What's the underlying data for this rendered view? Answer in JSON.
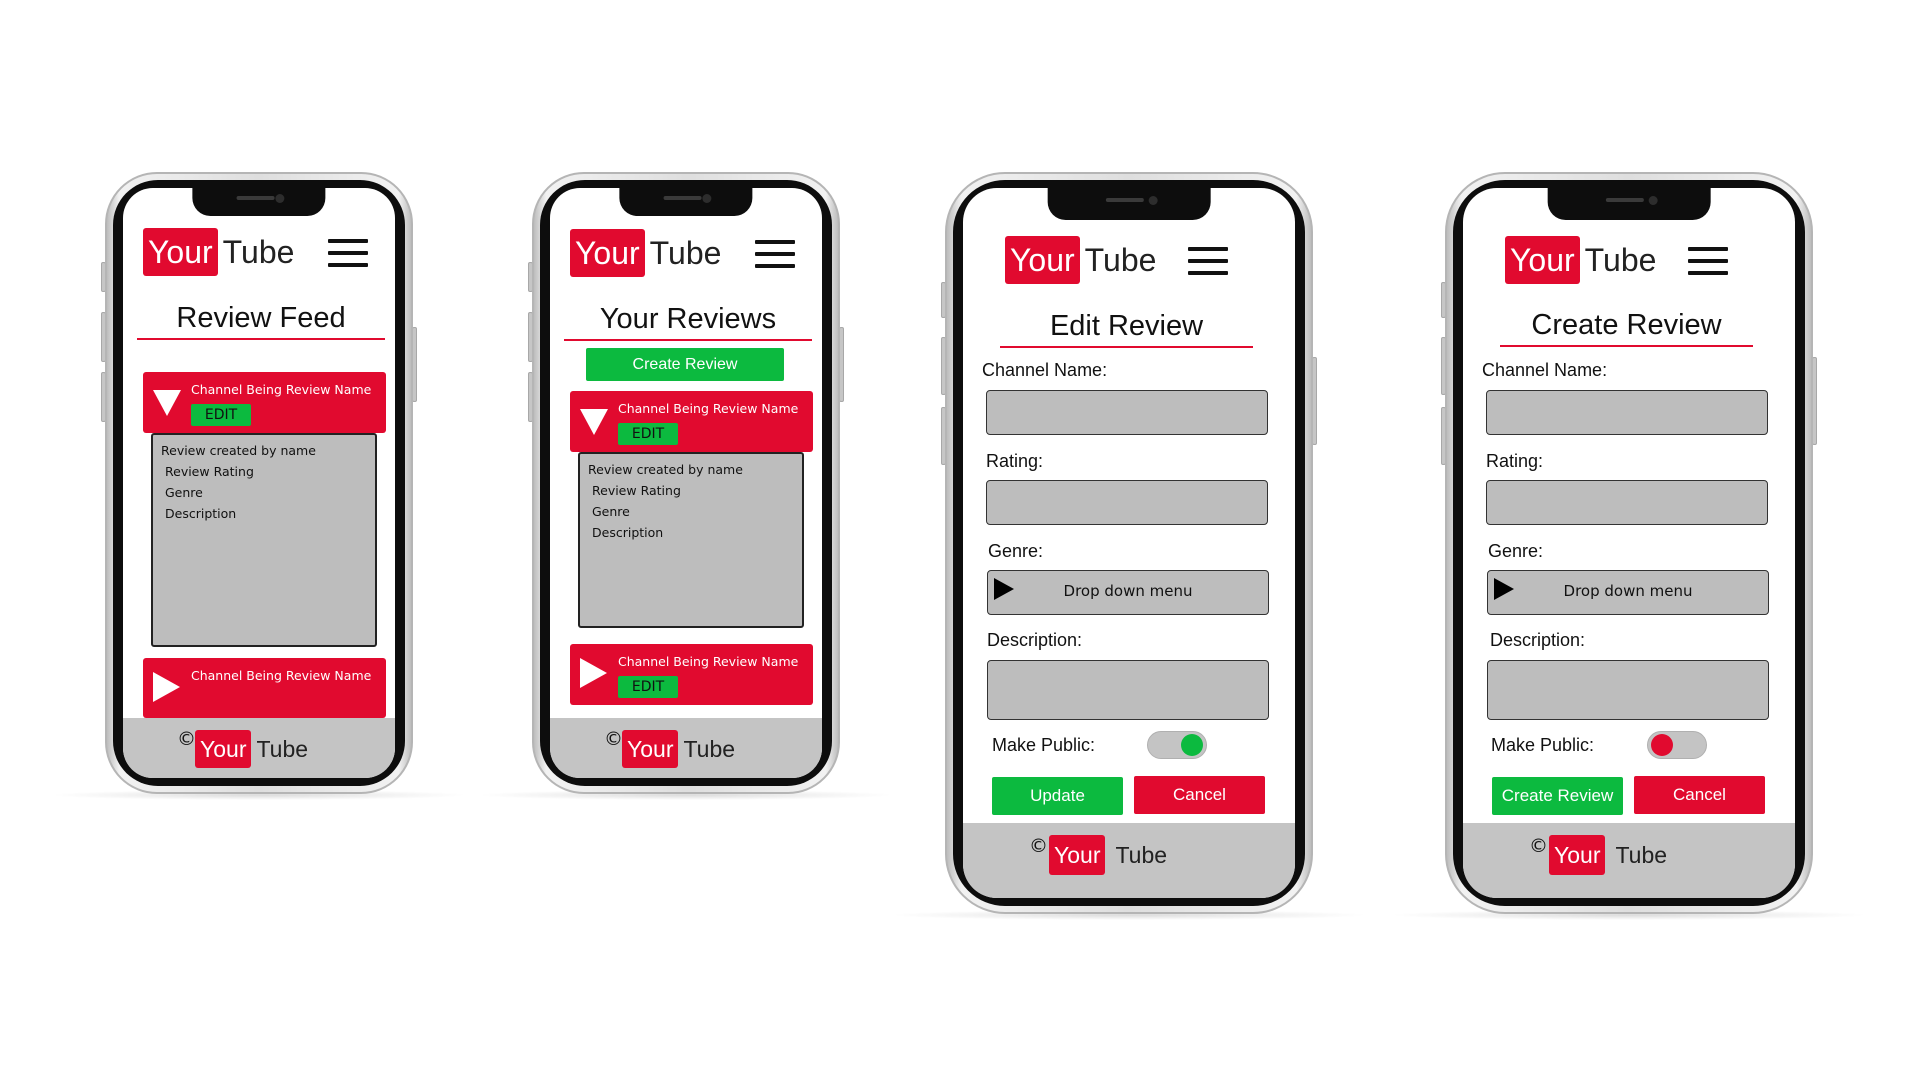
{
  "brand": {
    "logo_your": "Your",
    "logo_tube": "Tube",
    "copyright_symbol": "©",
    "accent_color": "#e10a2f",
    "success_color": "#0cba3f"
  },
  "screen_feed": {
    "title": "Review Feed",
    "cards": [
      {
        "name": "Channel Being Review Name",
        "edit_label": "EDIT",
        "expanded": true,
        "details": [
          "Review created by name",
          "Review Rating",
          "Genre",
          "Description"
        ]
      },
      {
        "name": "Channel Being Review Name",
        "expanded": false
      }
    ]
  },
  "screen_your_reviews": {
    "title": "Your Reviews",
    "create_button": "Create Review",
    "cards": [
      {
        "name": "Channel Being Review Name",
        "edit_label": "EDIT",
        "expanded": true,
        "details": [
          "Review created by name",
          "Review Rating",
          "Genre",
          "Description"
        ]
      },
      {
        "name": "Channel Being Review Name",
        "edit_label": "EDIT",
        "expanded": false
      }
    ]
  },
  "screen_edit": {
    "title": "Edit Review",
    "channel_label": "Channel Name:",
    "rating_label": "Rating:",
    "genre_label": "Genre:",
    "genre_dropdown": "Drop down menu",
    "description_label": "Description:",
    "public_label": "Make Public:",
    "public_on": true,
    "submit_button": "Update",
    "cancel_button": "Cancel"
  },
  "screen_create": {
    "title": "Create Review",
    "channel_label": "Channel Name:",
    "rating_label": "Rating:",
    "genre_label": "Genre:",
    "genre_dropdown": "Drop down menu",
    "description_label": "Description:",
    "public_label": "Make Public:",
    "public_on": false,
    "submit_button": "Create Review",
    "cancel_button": "Cancel"
  }
}
